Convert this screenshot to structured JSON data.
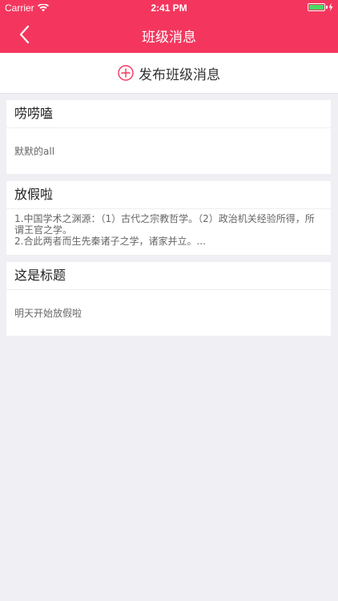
{
  "status_bar": {
    "carrier": "Carrier",
    "time": "2:41 PM"
  },
  "nav": {
    "title": "班级消息",
    "back_icon": "chevron-left-icon"
  },
  "publish": {
    "label": "发布班级消息",
    "icon": "plus-circle-icon"
  },
  "messages": [
    {
      "title": "唠唠嗑",
      "body": "默默的all"
    },
    {
      "title": "放假啦",
      "body": "1.中国学术之渊源：（1）古代之宗教哲学。（2）政治机关经验所得，所谓王官之学。\n2.合此两者而生先秦诸子之学，诸家并立。..."
    },
    {
      "title": "这是标题",
      "body": "明天开始放假啦"
    }
  ],
  "colors": {
    "header": "#f4365e",
    "background": "#efeff4",
    "battery": "#4cd964"
  }
}
